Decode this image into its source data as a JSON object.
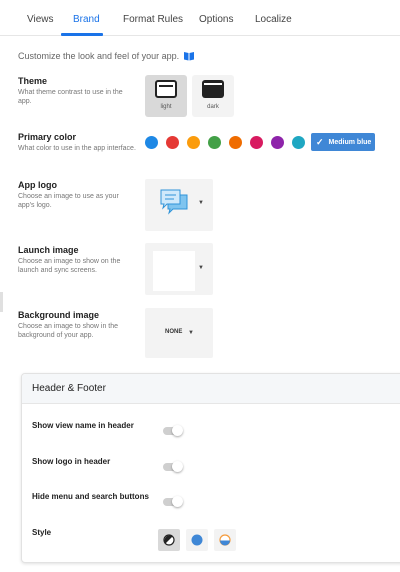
{
  "tabs": [
    {
      "label": "Views",
      "active": false
    },
    {
      "label": "Brand",
      "active": true
    },
    {
      "label": "Format Rules",
      "active": false
    },
    {
      "label": "Options",
      "active": false
    },
    {
      "label": "Localize",
      "active": false
    }
  ],
  "intro": "Customize the look and feel of your app.",
  "theme": {
    "title": "Theme",
    "description": "What theme contrast to use in the app.",
    "options": [
      {
        "label": "light",
        "selected": true
      },
      {
        "label": "dark",
        "selected": false
      }
    ]
  },
  "primary_color": {
    "title": "Primary color",
    "description": "What color to use in the app interface.",
    "swatches": [
      "#1e88e5",
      "#e53935",
      "#fb9c0c",
      "#43a047",
      "#ef6c00",
      "#d81b60",
      "#8e24aa",
      "#1fa7c2"
    ],
    "selected_label": "Medium blue",
    "selected_color": "#3f87d6"
  },
  "app_logo": {
    "title": "App logo",
    "description": "Choose an image to use as your app's logo."
  },
  "launch_image": {
    "title": "Launch image",
    "description": "Choose an image to show on the launch and sync screens."
  },
  "background_image": {
    "title": "Background image",
    "description": "Choose an image to show in the background of your app.",
    "value": "NONE"
  },
  "header_footer": {
    "title": "Header & Footer",
    "rows": [
      {
        "label": "Show view name in header",
        "on": false
      },
      {
        "label": "Show logo in header",
        "on": false
      },
      {
        "label": "Hide menu and search buttons",
        "on": false
      }
    ],
    "style_label": "Style",
    "style_selected": 0
  }
}
